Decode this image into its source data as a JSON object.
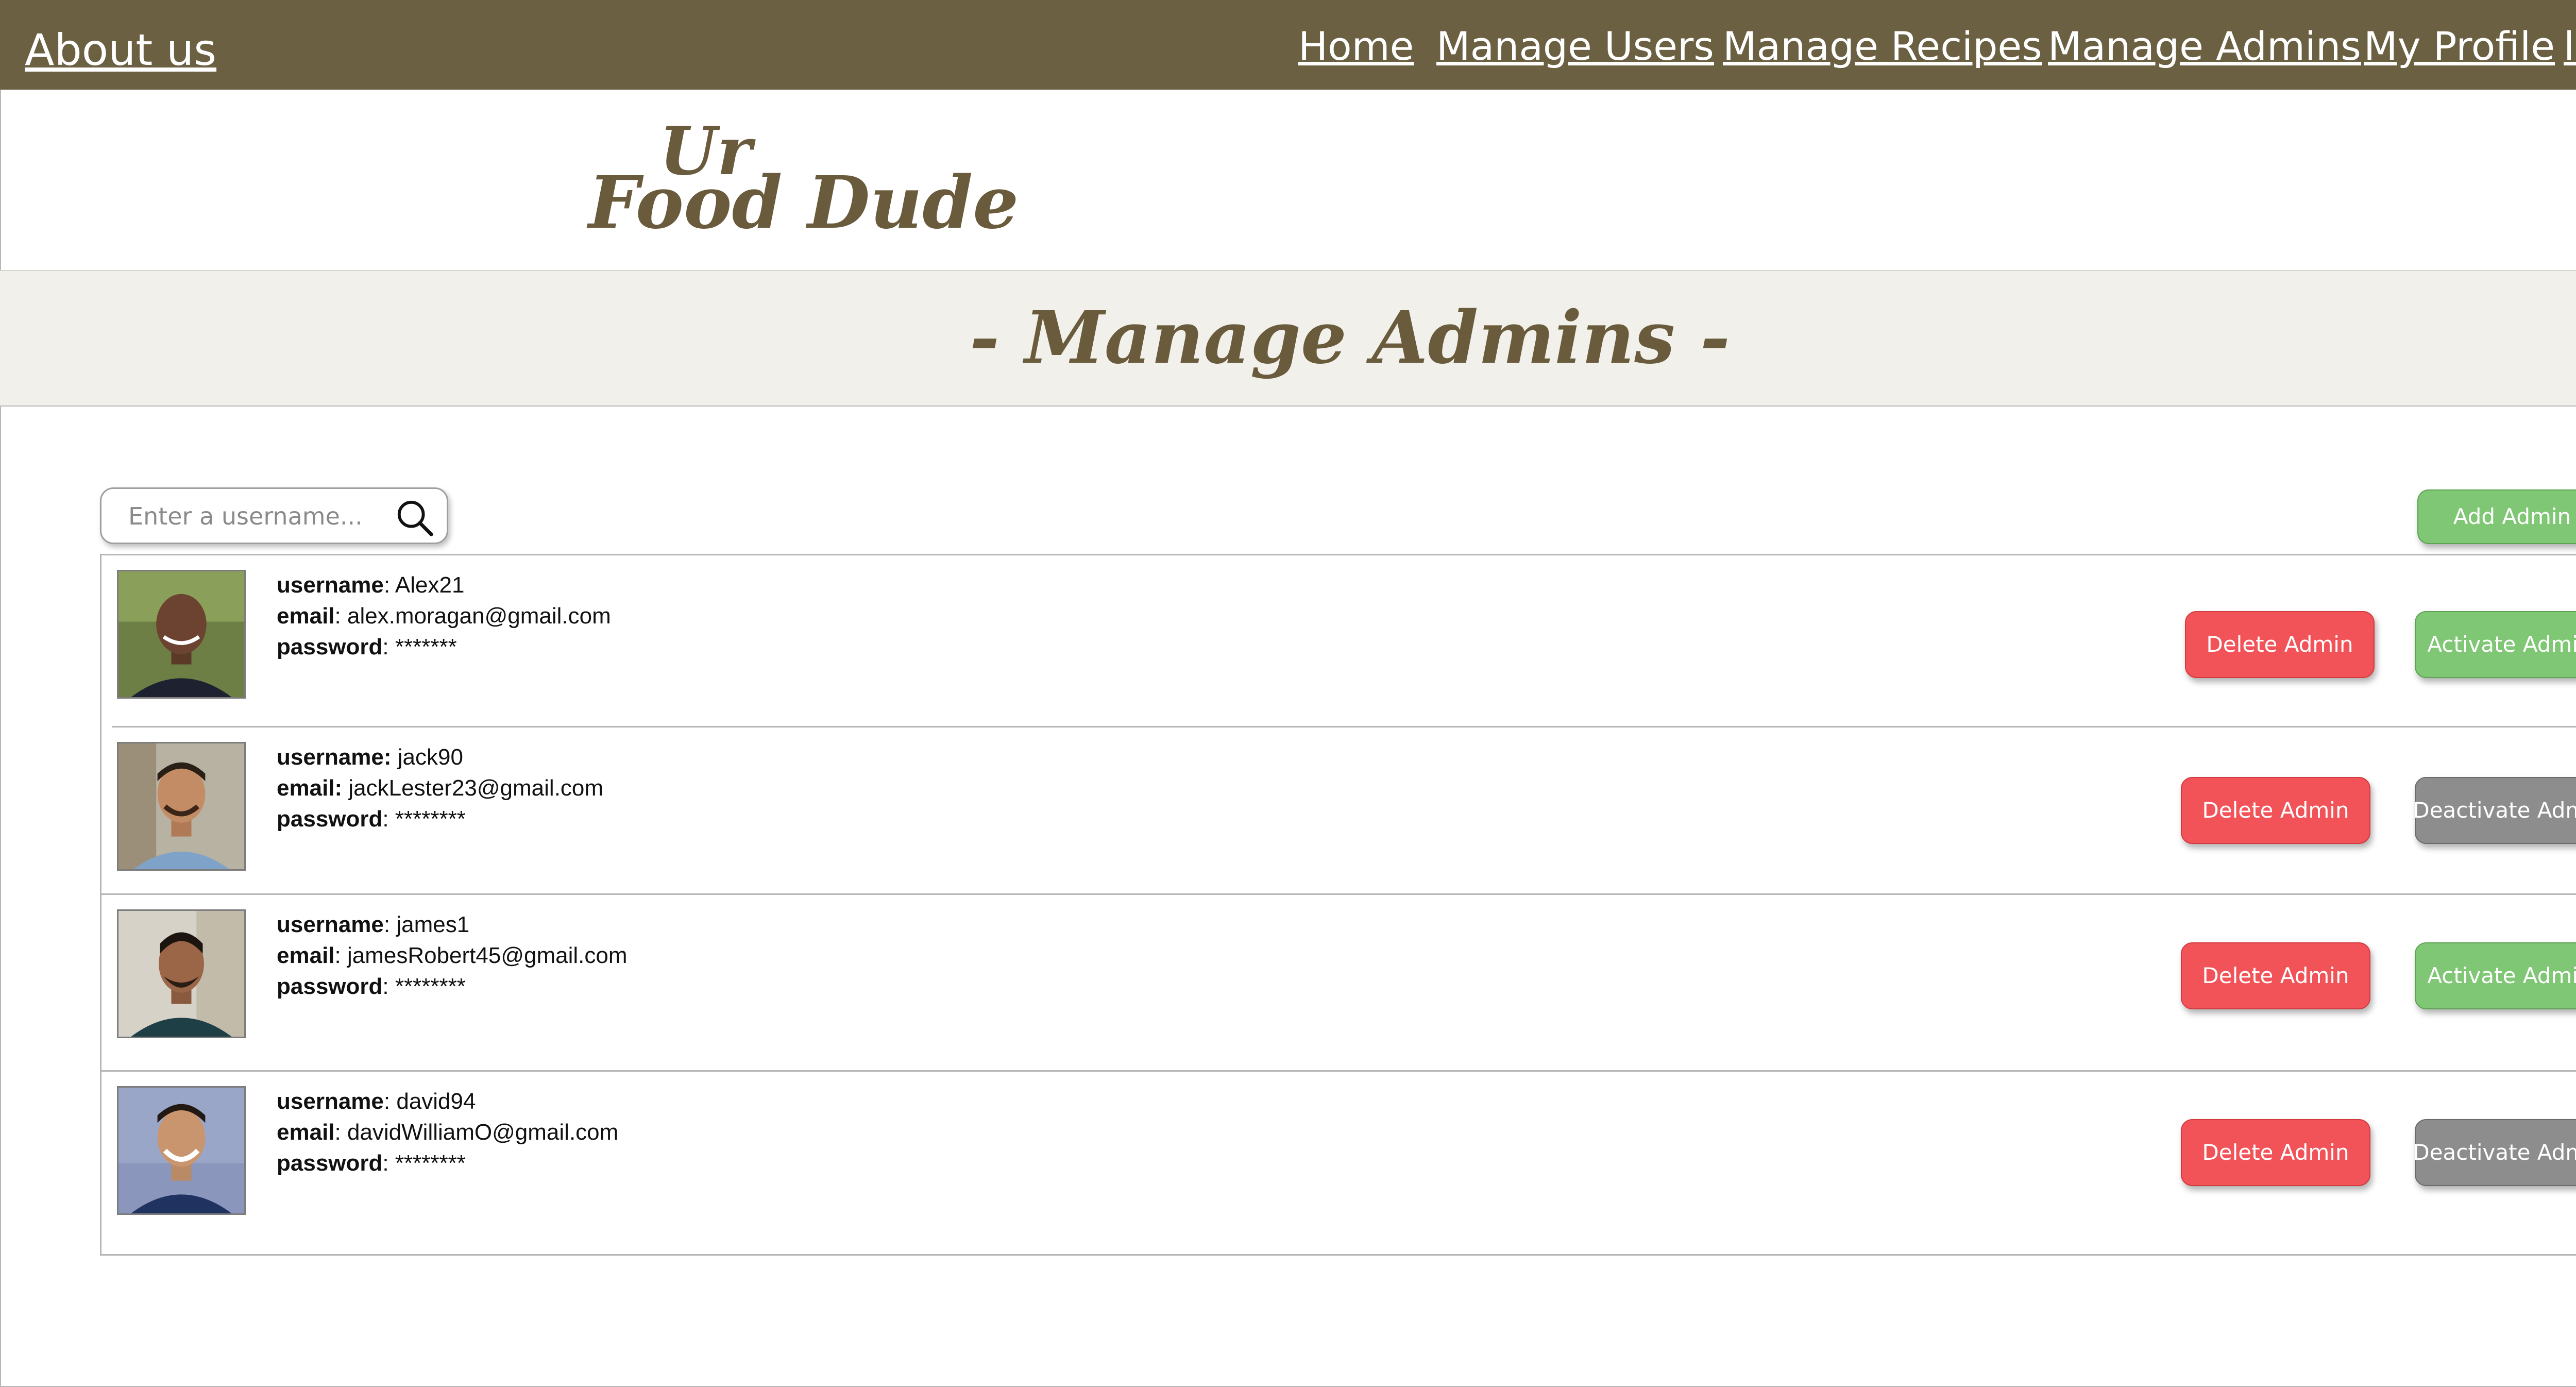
{
  "nav": {
    "about": "About us",
    "home": "Home",
    "manage_users": "Manage Users",
    "manage_recipes": "Manage Recipes",
    "manage_admins": "Manage Admins",
    "my_profile": "My Profile",
    "logout": "log out"
  },
  "logo": {
    "line1": "Ur",
    "line2": "Food Dude"
  },
  "page": {
    "title": "- Manage Admins -"
  },
  "search": {
    "placeholder": "Enter a username...",
    "value": ""
  },
  "add_button": "Add Admin",
  "labels": {
    "username": "username",
    "email": "email",
    "password": "password"
  },
  "admins": [
    {
      "username": "Alex21",
      "email": "alex.moragan@gmail.com",
      "password": "*******",
      "delete_label": "Delete Admin",
      "toggle_label": "Activate Admin",
      "toggle_state": "activate"
    },
    {
      "username": "jack90",
      "email": "jackLester23@gmail.com",
      "password": "********",
      "delete_label": "Delete Admin",
      "toggle_label": "Deactivate Admin",
      "toggle_state": "deactivate"
    },
    {
      "username": "james1",
      "email": "jamesRobert45@gmail.com",
      "password": "********",
      "delete_label": "Delete Admin",
      "toggle_label": "Activate Admin",
      "toggle_state": "activate"
    },
    {
      "username": "david94",
      "email": "davidWilliamO@gmail.com",
      "password": "********",
      "delete_label": "Delete Admin",
      "toggle_label": "Deactivate Admin",
      "toggle_state": "deactivate"
    }
  ],
  "colors": {
    "nav_bg": "#6b6142",
    "brand": "#695b3b",
    "title_band": "#f1f0eb",
    "activate": "#7fc774",
    "delete": "#f15358",
    "deactivate": "#8d8d8d"
  },
  "icons": {
    "search": "search-icon"
  }
}
